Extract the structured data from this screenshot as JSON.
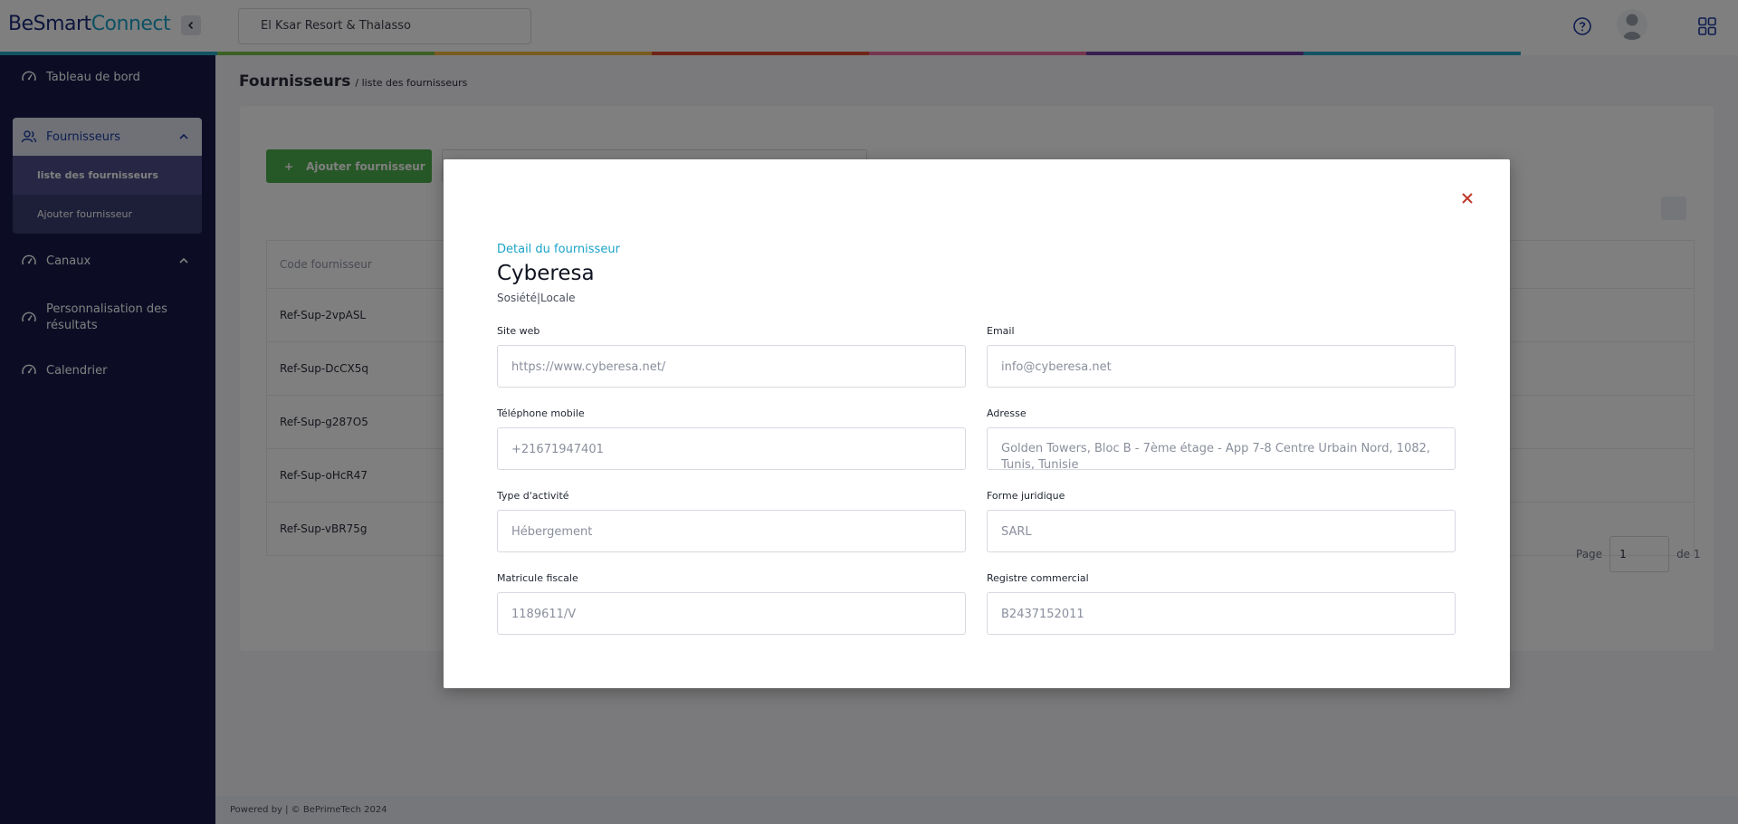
{
  "app": {
    "logo_part1": "BeSmart",
    "logo_part2": "Connect"
  },
  "header": {
    "hotel": "El Ksar Resort & Thalasso"
  },
  "rainbow": [
    "#26a9c6",
    "#7bc24a",
    "#f2b441",
    "#e0482c",
    "#ea6b9a",
    "#6a3fa0",
    "#26a9c6",
    "#ffffff"
  ],
  "sidebar": {
    "dashboard": "Tableau de bord",
    "suppliers": "Fournisseurs",
    "suppliers_list": "liste des fournisseurs",
    "add_supplier": "Ajouter fournisseur",
    "channels": "Canaux",
    "personalization": "Personnalisation des résultats",
    "calendar": "Calendrier"
  },
  "page": {
    "title": "Fournisseurs",
    "crumb": "/ liste des fournisseurs",
    "add_button": "Ajouter fournisseur",
    "table_header": "Code fournisseur",
    "rows": [
      "Ref-Sup-2vpASL",
      "Ref-Sup-DcCX5q",
      "Ref-Sup-g287O5",
      "Ref-Sup-oHcR47",
      "Ref-Sup-vBR75g"
    ],
    "pager_label": "Page",
    "pager_value": "1",
    "pager_total": "de 1"
  },
  "footer": {
    "text": "Powered by | © BePrimeTech 2024"
  },
  "modal": {
    "kicker": "Detail du fournisseur",
    "name": "Cyberesa",
    "subtitle": "Sosiété|Locale",
    "fields": {
      "website": {
        "label": "Site web",
        "value": "https://www.cyberesa.net/"
      },
      "email": {
        "label": "Email",
        "value": "info@cyberesa.net"
      },
      "phone": {
        "label": "Téléphone mobile",
        "value": "+21671947401"
      },
      "address": {
        "label": "Adresse",
        "value": "Golden Towers, Bloc B - 7ème étage - App 7-8 Centre Urbain Nord, 1082, Tunis, Tunisie"
      },
      "activity": {
        "label": "Type d'activité",
        "value": "Hébergement"
      },
      "legal_form": {
        "label": "Forme juridique",
        "value": "SARL"
      },
      "tax_id": {
        "label": "Matricule fiscale",
        "value": "1189611/V"
      },
      "trade_register": {
        "label": "Registre commercial",
        "value": "B2437152011"
      }
    }
  }
}
